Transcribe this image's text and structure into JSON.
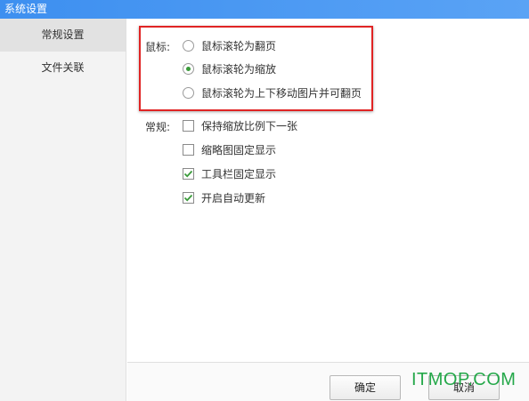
{
  "window": {
    "title": "系统设置"
  },
  "sidebar": {
    "items": [
      {
        "label": "常规设置"
      },
      {
        "label": "文件关联"
      }
    ]
  },
  "mouse_group": {
    "label": "鼠标:",
    "options": [
      {
        "label": "鼠标滚轮为翻页",
        "selected": false
      },
      {
        "label": "鼠标滚轮为缩放",
        "selected": true
      },
      {
        "label": "鼠标滚轮为上下移动图片并可翻页",
        "selected": false
      }
    ]
  },
  "general_group": {
    "label": "常规:",
    "options": [
      {
        "label": "保持缩放比例下一张",
        "checked": false
      },
      {
        "label": "缩略图固定显示",
        "checked": false
      },
      {
        "label": "工具栏固定显示",
        "checked": true
      },
      {
        "label": "开启自动更新",
        "checked": true
      }
    ]
  },
  "buttons": {
    "ok": "确定",
    "cancel": "取消"
  },
  "watermark": "ITMOP.COM",
  "colors": {
    "titlebar": "#3d8ff0",
    "highlight_border": "#e02424",
    "radio_selected": "#3a9a3a",
    "check_mark": "#3a9a3a",
    "watermark": "#25a84a"
  }
}
